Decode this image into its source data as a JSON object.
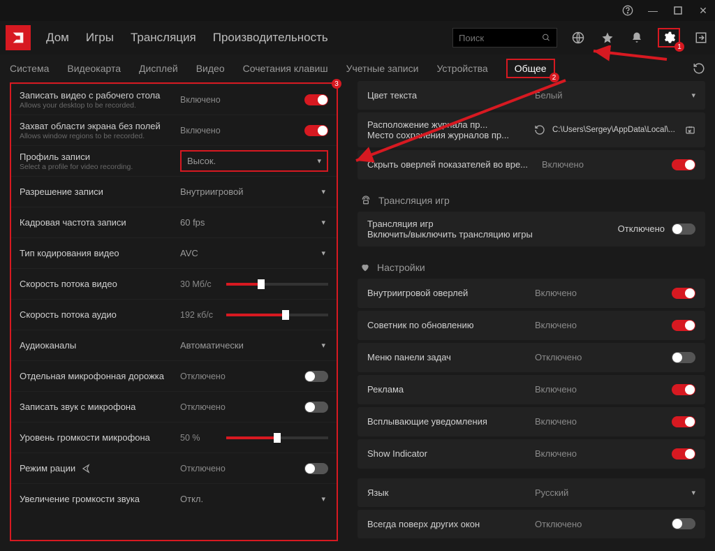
{
  "titlebar": {
    "help": "?",
    "min": "—",
    "max": "▢",
    "close": "✕"
  },
  "nav": {
    "home": "Дом",
    "games": "Игры",
    "stream": "Трансляция",
    "perf": "Производительность"
  },
  "search": {
    "placeholder": "Поиск"
  },
  "badges": {
    "gear": "1",
    "tab": "2",
    "panel": "3"
  },
  "subtabs": {
    "system": "Система",
    "gpu": "Видеокарта",
    "display": "Дисплей",
    "video": "Видео",
    "hotkeys": "Сочетания клавиш",
    "accounts": "Учетные записи",
    "devices": "Устройства",
    "general": "Общее"
  },
  "left_rows": [
    {
      "label": "Записать видео с рабочего стола",
      "sub": "Allows your desktop to be recorded.",
      "type": "toggle",
      "value": "Включено",
      "on": true
    },
    {
      "label": "Захват области экрана без полей",
      "sub": "Allows window regions to be recorded.",
      "type": "toggle",
      "value": "Включено",
      "on": true
    },
    {
      "label": "Профиль записи",
      "sub": "Select a profile for video recording.",
      "type": "dropdown",
      "value": "Высок.",
      "hl": true
    },
    {
      "label": "Разрешение записи",
      "type": "dropdown",
      "value": "Внутриигровой"
    },
    {
      "label": "Кадровая частота записи",
      "type": "dropdown",
      "value": "60 fps"
    },
    {
      "label": "Тип кодирования видео",
      "type": "dropdown",
      "value": "AVC"
    },
    {
      "label": "Скорость потока видео",
      "type": "slider",
      "value": "30 Мб/с",
      "fill": 34
    },
    {
      "label": "Скорость потока аудио",
      "type": "slider",
      "value": "192 кб/с",
      "fill": 58
    },
    {
      "label": "Аудиоканалы",
      "type": "dropdown",
      "value": "Автоматически"
    },
    {
      "label": "Отдельная микрофонная дорожка",
      "type": "toggle",
      "value": "Отключено",
      "on": false
    },
    {
      "label": "Записать звук с микрофона",
      "type": "toggle",
      "value": "Отключено",
      "on": false
    },
    {
      "label": "Уровень громкости микрофона",
      "type": "slider",
      "value": "50 %",
      "fill": 50
    },
    {
      "label": "Режим рации",
      "type": "toggle",
      "value": "Отключено",
      "on": false,
      "icon": "share"
    },
    {
      "label": "Увеличение громкости звука",
      "type": "dropdown",
      "value": "Откл."
    }
  ],
  "right_top": {
    "text_color_label": "Цвет текста",
    "text_color_value": "Белый",
    "log_loc_label": "Расположение журнала пр...",
    "log_loc_sub": "Место сохранения журналов пр...",
    "log_loc_path": "C:\\Users\\Sergey\\AppData\\Local\\...",
    "hide_overlay_label": "Скрыть оверлей показателей во вре...",
    "hide_overlay_value": "Включено"
  },
  "section_stream": "Трансляция игр",
  "stream_row": {
    "label": "Трансляция игр",
    "sub": "Включить/выключить трансляцию игры",
    "value": "Отключено"
  },
  "section_settings": "Настройки",
  "settings_rows": [
    {
      "label": "Внутриигровой оверлей",
      "value": "Включено",
      "on": true
    },
    {
      "label": "Советник по обновлению",
      "value": "Включено",
      "on": true
    },
    {
      "label": "Меню панели задач",
      "value": "Отключено",
      "on": false
    },
    {
      "label": "Реклама",
      "value": "Включено",
      "on": true
    },
    {
      "label": "Всплывающие уведомления",
      "value": "Включено",
      "on": true
    },
    {
      "label": "Show Indicator",
      "value": "Включено",
      "on": true
    }
  ],
  "lang_row": {
    "label": "Язык",
    "value": "Русский"
  },
  "ontop_row": {
    "label": "Всегда поверх других окон",
    "value": "Отключено",
    "on": false
  }
}
